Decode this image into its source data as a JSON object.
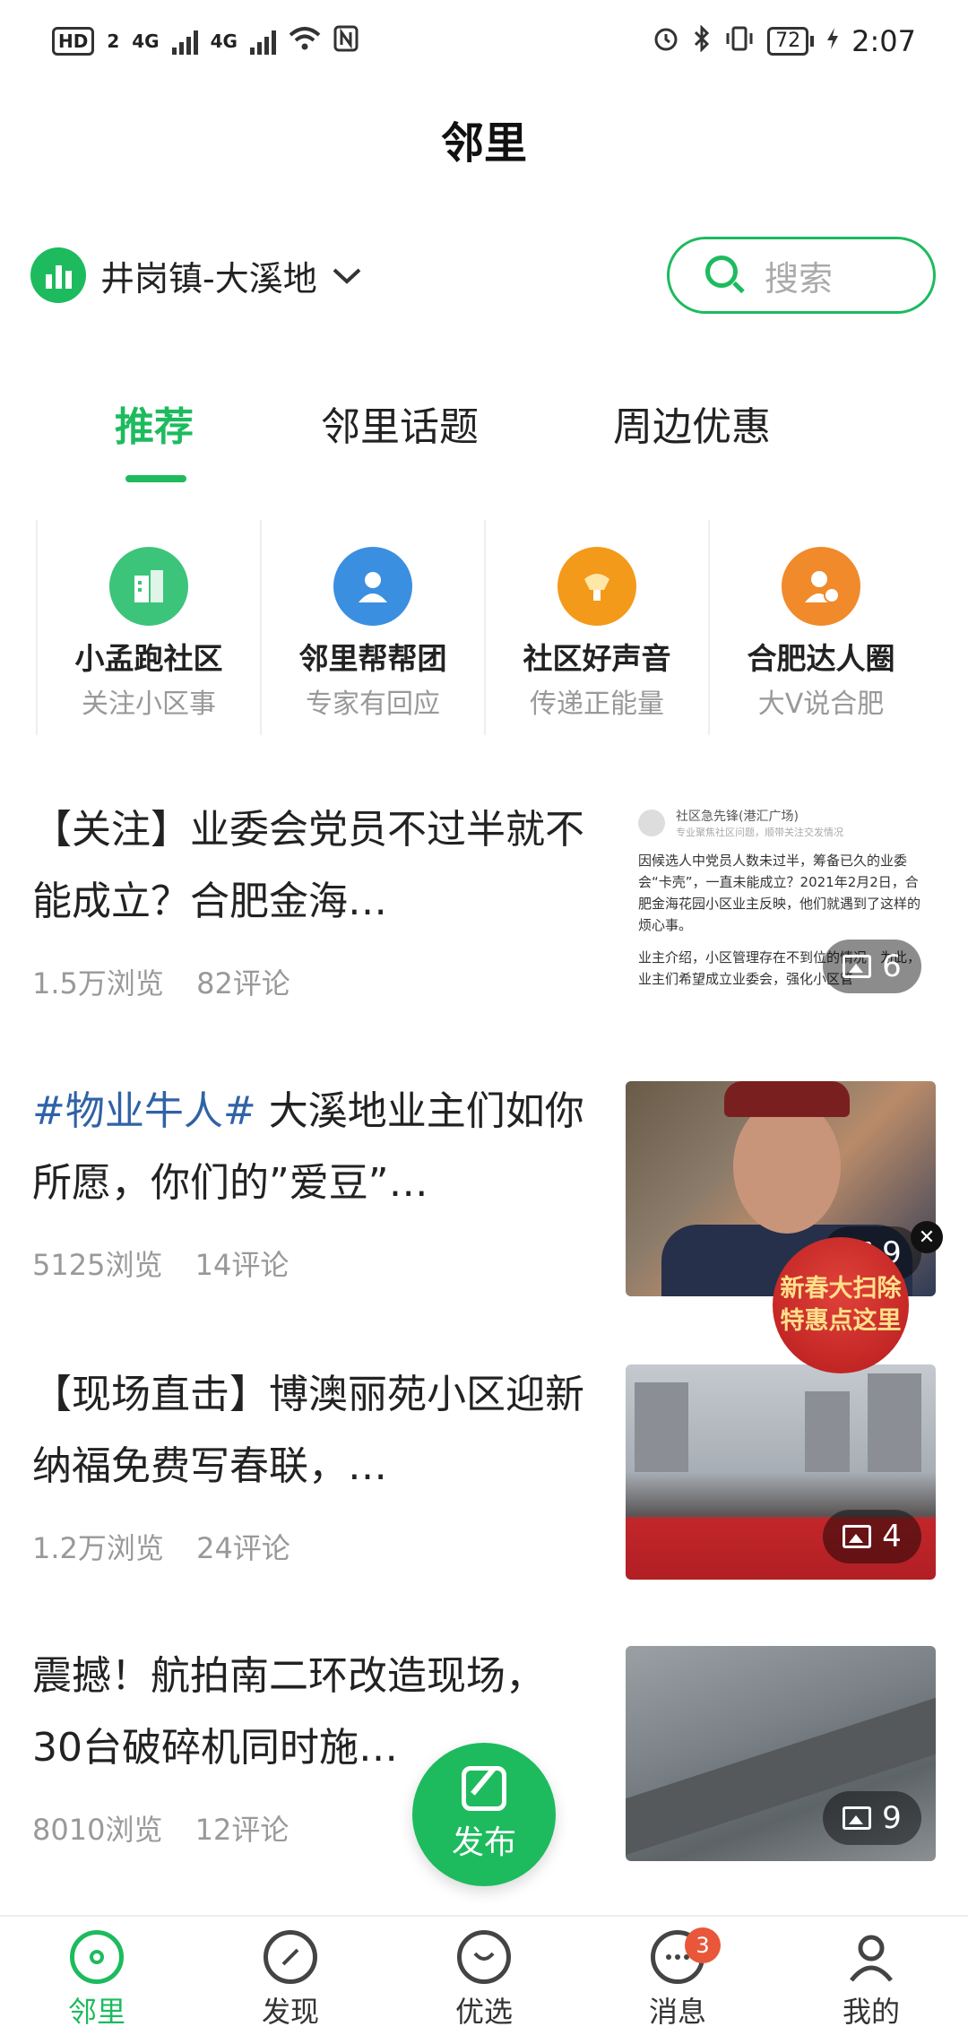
{
  "status_bar": {
    "hd": "HD",
    "hd_sub": "2",
    "net1": "4G",
    "net2": "4G",
    "battery": "72",
    "time": "2:07"
  },
  "header": {
    "title": "邻里"
  },
  "location": {
    "name": "井岗镇-大溪地"
  },
  "search": {
    "placeholder": "搜索"
  },
  "tabs": [
    {
      "label": "推荐",
      "active": true
    },
    {
      "label": "邻里话题",
      "active": false
    },
    {
      "label": "周边优惠",
      "active": false
    }
  ],
  "quick_entries": [
    {
      "title": "小孟跑社区",
      "subtitle": "关注小区事",
      "color": "#3cc47a"
    },
    {
      "title": "邻里帮帮团",
      "subtitle": "专家有回应",
      "color": "#3b8fe0"
    },
    {
      "title": "社区好声音",
      "subtitle": "传递正能量",
      "color": "#f39a1a"
    },
    {
      "title": "合肥达人圈",
      "subtitle": "大V说合肥",
      "color": "#f08a2a"
    }
  ],
  "feed": [
    {
      "title": "【关注】业委会党员不过半就不能成立？合肥金海…",
      "tag": "",
      "views": "1.5万浏览",
      "comments": "82评论",
      "image_count": "6",
      "doc_name": "社区急先锋(港汇广场)",
      "doc_sub": "专业聚焦社区问题，顺带关注交发情况",
      "doc_text": "因候选人中党员人数未过半，筹备已久的业委会“卡壳”，一直未能成立？2021年2月2日，合肥金海花园小区业主反映，他们就遇到了这样的烦心事。",
      "doc_text2": "业主介绍，小区管理存在不到位的情况，为此，业主们希望成立业委会，强化小区管"
    },
    {
      "title": "大溪地业主们如你所愿，你们的”爱豆”…",
      "tag": "#物业牛人#",
      "views": "5125浏览",
      "comments": "14评论",
      "image_count": "9"
    },
    {
      "title": "【现场直击】博澳丽苑小区迎新纳福免费写春联，…",
      "tag": "",
      "views": "1.2万浏览",
      "comments": "24评论",
      "image_count": "4"
    },
    {
      "title": "震撼！航拍南二环改造现场，30台破碎机同时施…",
      "tag": "",
      "views": "8010浏览",
      "comments": "12评论",
      "image_count": "9"
    }
  ],
  "promo": {
    "line1": "新春大扫除",
    "line2": "特惠点这里"
  },
  "fab": {
    "label": "发布"
  },
  "bottom_nav": [
    {
      "label": "邻里",
      "active": true
    },
    {
      "label": "发现",
      "active": false
    },
    {
      "label": "优选",
      "active": false
    },
    {
      "label": "消息",
      "active": false,
      "badge": "3"
    },
    {
      "label": "我的",
      "active": false
    }
  ]
}
